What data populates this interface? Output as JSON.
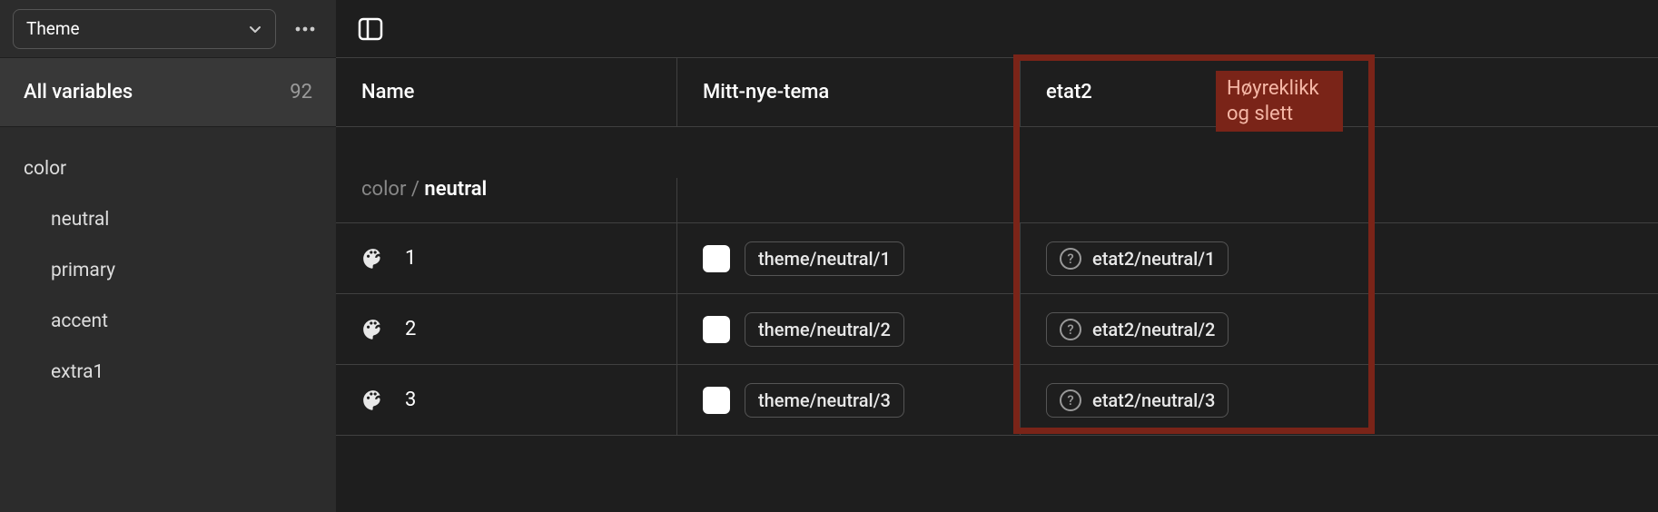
{
  "sidebar": {
    "selector_label": "Theme",
    "all_variables_label": "All variables",
    "all_variables_count": "92",
    "tree": {
      "root": "color",
      "children": [
        "neutral",
        "primary",
        "accent",
        "extra1"
      ]
    }
  },
  "table": {
    "columns": {
      "name": "Name",
      "mode1": "Mitt-nye-tema",
      "mode2": "etat2"
    },
    "group": {
      "path_dim": "color / ",
      "path_strong": "neutral"
    },
    "rows": [
      {
        "name": "1",
        "mode1": "theme/neutral/1",
        "mode2": "etat2/neutral/1"
      },
      {
        "name": "2",
        "mode1": "theme/neutral/2",
        "mode2": "etat2/neutral/2"
      },
      {
        "name": "3",
        "mode1": "theme/neutral/3",
        "mode2": "etat2/neutral/3"
      }
    ]
  },
  "annotation": {
    "text": "Høyreklikk og slett"
  }
}
